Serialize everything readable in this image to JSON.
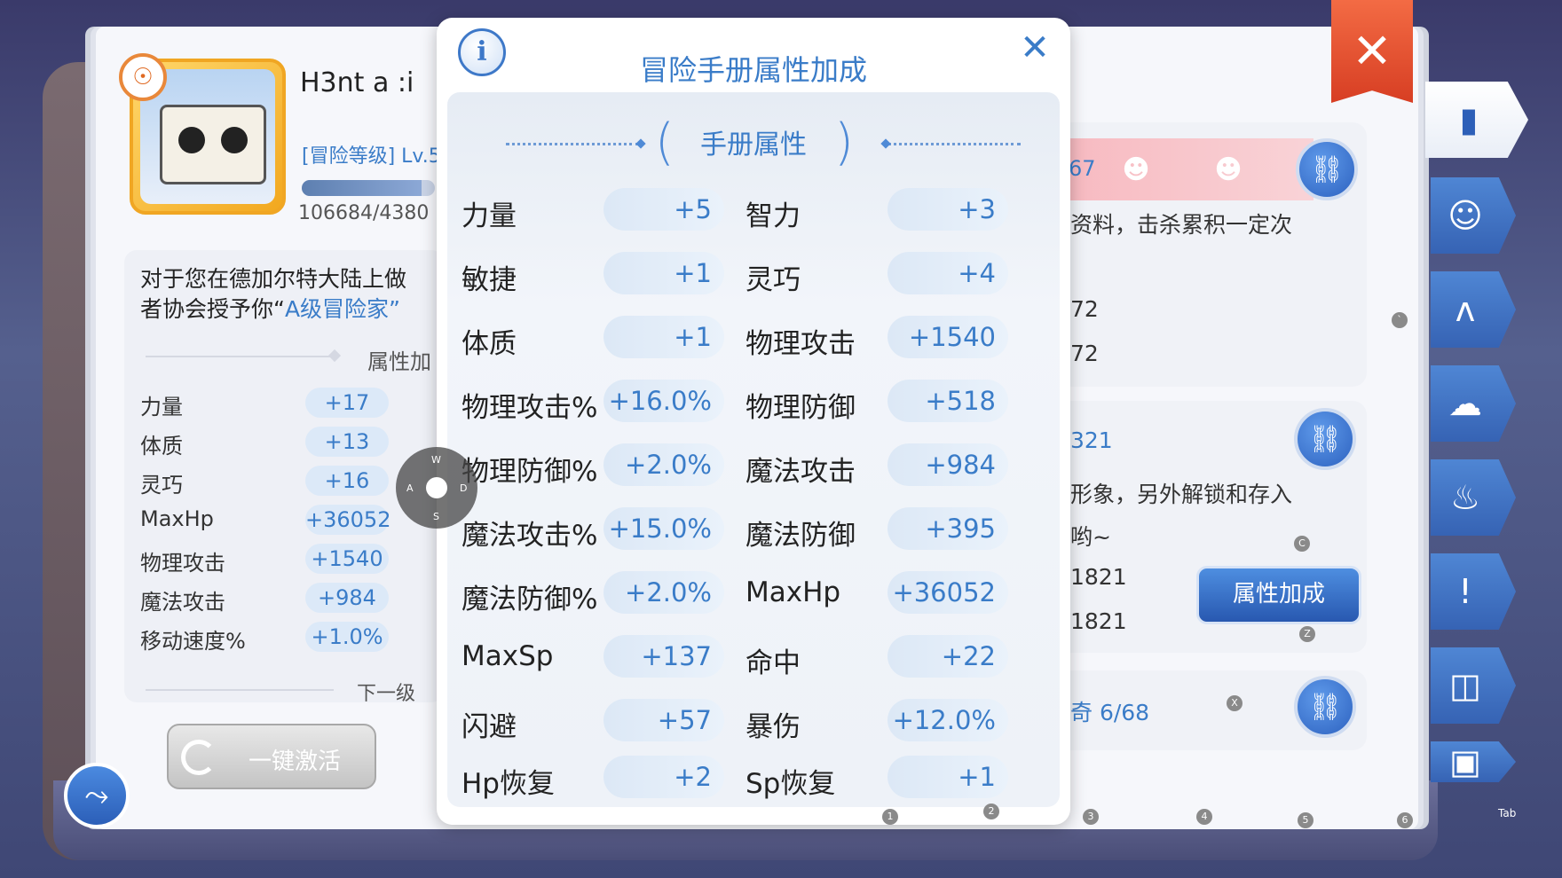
{
  "colors": {
    "accent": "#3a7cc8",
    "close": "#e2502e",
    "tab": "#3f70c2"
  },
  "player": {
    "name": "H3nt a :i",
    "adventure_level": "[冒险等级] Lv.5",
    "exp": "106684/4380",
    "exp_progress": 0.9
  },
  "left_page": {
    "description_line1": "对于您在德加尔特大陆上做",
    "description_line2_prefix": "者协会授予你“",
    "description_line2_highlight": "A级冒险家”",
    "attr_section_title": "属性加",
    "next_level_title": "下一级",
    "stats": [
      {
        "label": "力量",
        "value": "+17"
      },
      {
        "label": "体质",
        "value": "+13"
      },
      {
        "label": "灵巧",
        "value": "+16"
      },
      {
        "label": "MaxHp",
        "value": "+36052"
      },
      {
        "label": "物理攻击",
        "value": "+1540"
      },
      {
        "label": "魔法攻击",
        "value": "+984"
      },
      {
        "label": "移动速度%",
        "value": "+1.0%"
      }
    ],
    "activate_button": "一键激活"
  },
  "right_page": {
    "card1_count": "67",
    "card1_text": "资料，击杀累积一定次",
    "card1_line2": "72",
    "card1_line3": "72",
    "card2_count": "321",
    "card2_text": "形象，另外解锁和存入",
    "card2_text2": "哟~",
    "card2_line3": "1821",
    "card2_line4": "1821",
    "card3_text": "奇 6/68",
    "attr_bonus_button": "属性加成"
  },
  "popup": {
    "title": "冒险手册属性加成",
    "section_title": "手册属性",
    "stats": [
      {
        "label": "力量",
        "value": "+5"
      },
      {
        "label": "智力",
        "value": "+3"
      },
      {
        "label": "敏捷",
        "value": "+1"
      },
      {
        "label": "灵巧",
        "value": "+4"
      },
      {
        "label": "体质",
        "value": "+1"
      },
      {
        "label": "物理攻击",
        "value": "+1540"
      },
      {
        "label": "物理攻击%",
        "value": "+16.0%"
      },
      {
        "label": "物理防御",
        "value": "+518"
      },
      {
        "label": "物理防御%",
        "value": "+2.0%"
      },
      {
        "label": "魔法攻击",
        "value": "+984"
      },
      {
        "label": "魔法攻击%",
        "value": "+15.0%"
      },
      {
        "label": "魔法防御",
        "value": "+395"
      },
      {
        "label": "魔法防御%",
        "value": "+2.0%"
      },
      {
        "label": "MaxHp",
        "value": "+36052"
      },
      {
        "label": "MaxSp",
        "value": "+137"
      },
      {
        "label": "命中",
        "value": "+22"
      },
      {
        "label": "闪避",
        "value": "+57"
      },
      {
        "label": "暴伤",
        "value": "+12.0%"
      },
      {
        "label": "Hp恢复",
        "value": "+2"
      },
      {
        "label": "Sp恢复",
        "value": "+1"
      }
    ]
  },
  "joystick": {
    "up": "W",
    "left": "A",
    "down": "S",
    "right": "D"
  },
  "hotkeys": {
    "k1": "1",
    "k2": "2",
    "k3": "3",
    "k4": "4",
    "k5": "5",
    "k6": "6",
    "c": "C",
    "z": "Z",
    "x": "X",
    "grave": "`",
    "tab": "Tab"
  }
}
